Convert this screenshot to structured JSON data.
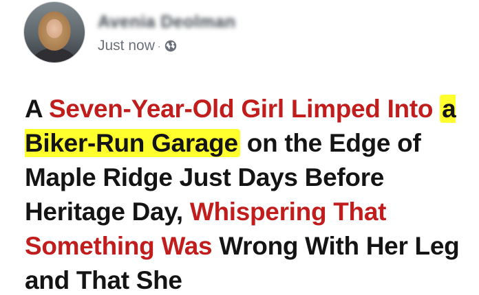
{
  "post": {
    "author_name": "Avenia Deolman",
    "timestamp": "Just now",
    "separator": "·",
    "audience_icon": "globe-icon"
  },
  "headline": {
    "segments": [
      {
        "text": "A ",
        "style": "black"
      },
      {
        "text": "Seven-Year-Old Girl Limped Into ",
        "style": "red"
      },
      {
        "text": "a Biker-Run Garage",
        "style": "highlight"
      },
      {
        "text": " on the Edge of Maple Ridge Just Days Before Heritage Day, ",
        "style": "black"
      },
      {
        "text": "Whispering That Something Was",
        "style": "red"
      },
      {
        "text": " Wrong With Her Leg and That She",
        "style": "black"
      }
    ]
  },
  "colors": {
    "red_text": "#c21d1d",
    "highlight": "#ffff2e",
    "body_text": "#141414",
    "meta_text": "#6b7079"
  }
}
